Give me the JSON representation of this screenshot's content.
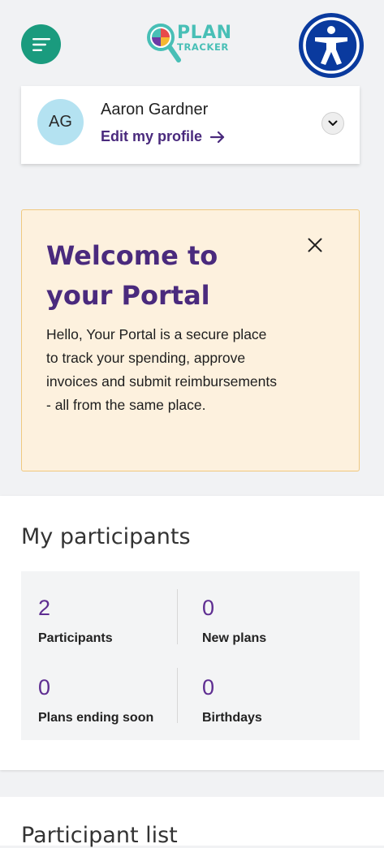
{
  "header": {
    "menu_icon": "menu-lines-icon",
    "logo": {
      "line1": "PLAN",
      "line2": "TRACKER"
    },
    "accessibility_icon": "accessibility-person-icon",
    "colors": {
      "menu": "#1a9b7e",
      "accessibility": "#0a3a9e",
      "logo": "#48bfb6"
    }
  },
  "profile": {
    "initials": "AG",
    "name": "Aaron Gardner",
    "edit_label": "Edit my profile",
    "edit_icon": "arrow-right-icon",
    "expand_icon": "chevron-down-icon"
  },
  "welcome": {
    "title": "Welcome to your Portal",
    "body": "Hello, Your Portal is a secure place to track your spending, approve invoices and submit reimbursements - all from the same place.",
    "close_icon": "close-icon",
    "colors": {
      "background": "#fdf1de",
      "border": "#f0c87e",
      "title": "#4a2a7d"
    }
  },
  "participants": {
    "title": "My participants",
    "stats": [
      {
        "value": "2",
        "label": "Participants"
      },
      {
        "value": "0",
        "label": "New plans"
      },
      {
        "value": "0",
        "label": "Plans ending soon"
      },
      {
        "value": "0",
        "label": "Birthdays"
      }
    ],
    "value_color": "#5e2d91"
  },
  "next_section": {
    "title": "Participant list"
  }
}
